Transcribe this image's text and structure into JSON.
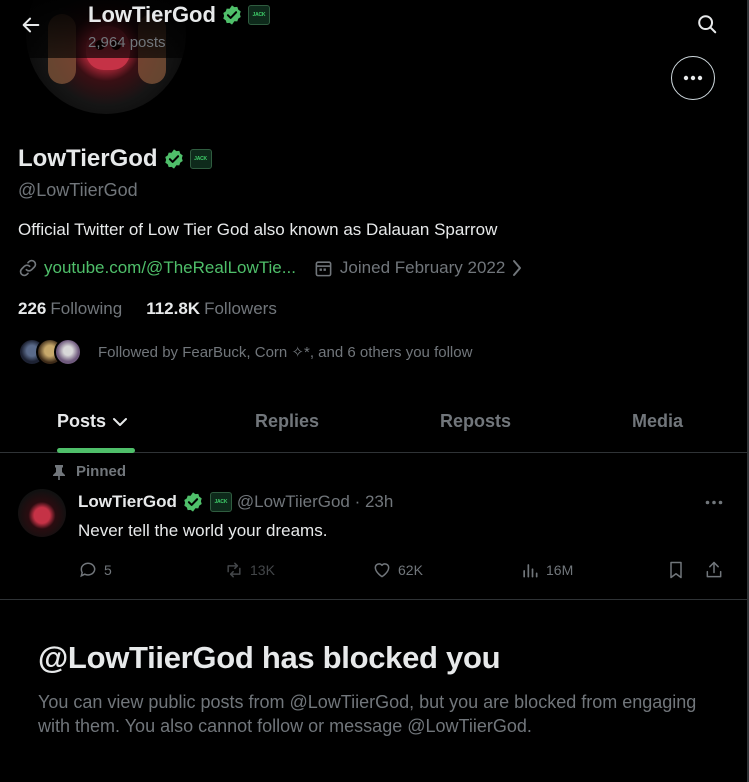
{
  "header": {
    "name": "LowTierGod",
    "post_count": "2,964 posts",
    "back_icon": "arrow-left-icon",
    "search_icon": "search-icon"
  },
  "profile": {
    "display_name": "LowTierGod",
    "handle": "@LowTiierGod",
    "bio": "Official Twitter of Low Tier God also known as Dalauan Sparrow",
    "link": "youtube.com/@TheRealLowTie...",
    "joined": "Joined February 2022",
    "badge_text": "JACK",
    "following_count": "226",
    "following_label": "Following",
    "followers_count": "112.8K",
    "followers_label": "Followers",
    "followed_by": "Followed by FearBuck, Corn ✧*, and 6 others you follow"
  },
  "tabs": [
    {
      "label": "Posts"
    },
    {
      "label": "Replies"
    },
    {
      "label": "Reposts"
    },
    {
      "label": "Media"
    }
  ],
  "post": {
    "pinned_label": "Pinned",
    "author": "LowTierGod",
    "handle_time": "@LowTiierGod · 23h",
    "text": "Never tell the world your dreams.",
    "replies": "5",
    "reposts": "13K",
    "likes": "62K",
    "views": "16M"
  },
  "blocked": {
    "title": "@LowTiierGod has blocked you",
    "body": "You can view public posts from @LowTiierGod, but you are blocked from engaging with them. You also cannot follow or message @LowTiierGod."
  },
  "colors": {
    "accent": "#4fbf6a",
    "verified": "#4fbf6a",
    "muted": "#71767b",
    "text": "#e7e9ea",
    "border": "#2f3336"
  }
}
